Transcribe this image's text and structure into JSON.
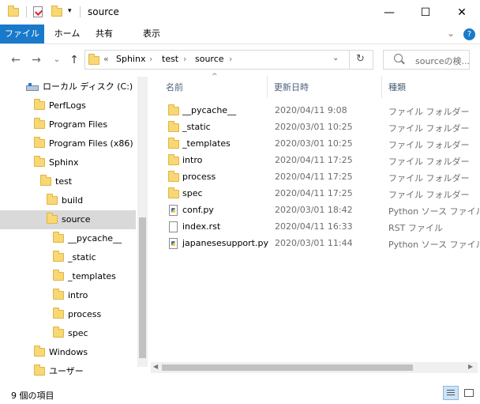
{
  "window": {
    "title": "source",
    "minimize_glyph": "—",
    "maximize_glyph": "☐",
    "close_glyph": "✕"
  },
  "ribbon": {
    "tabs": [
      "ファイル",
      "ホーム",
      "共有",
      "表示"
    ],
    "collapse_glyph": "⌄",
    "help_glyph": "?"
  },
  "nav": {
    "back_glyph": "←",
    "forward_glyph": "→",
    "recent_glyph": "⌄",
    "up_glyph": "↑",
    "overflow": "«",
    "breadcrumbs": [
      "Sphinx",
      "test",
      "source"
    ],
    "refresh_glyph": "↻",
    "search_placeholder": "sourceの検..."
  },
  "tree": [
    {
      "label": "ローカル ディスク (C:)",
      "icon": "drive-icon"
    },
    {
      "label": "PerfLogs",
      "icon": "folder-icon"
    },
    {
      "label": "Program Files",
      "icon": "folder-icon"
    },
    {
      "label": "Program Files (x86)",
      "icon": "folder-icon"
    },
    {
      "label": "Sphinx",
      "icon": "folder-icon"
    },
    {
      "label": "test",
      "icon": "folder-icon"
    },
    {
      "label": "build",
      "icon": "folder-icon"
    },
    {
      "label": "source",
      "icon": "folder-icon",
      "selected": true
    },
    {
      "label": "__pycache__",
      "icon": "folder-icon"
    },
    {
      "label": "_static",
      "icon": "folder-icon"
    },
    {
      "label": "_templates",
      "icon": "folder-icon"
    },
    {
      "label": "intro",
      "icon": "folder-icon"
    },
    {
      "label": "process",
      "icon": "folder-icon"
    },
    {
      "label": "spec",
      "icon": "folder-icon"
    },
    {
      "label": "Windows",
      "icon": "folder-icon"
    },
    {
      "label": "ユーザー",
      "icon": "folder-icon"
    }
  ],
  "columns": {
    "name": "名前",
    "date": "更新日時",
    "type": "種類",
    "sort_glyph": "^"
  },
  "files": [
    {
      "name": "__pycache__",
      "date": "2020/04/11 9:08",
      "type": "ファイル フォルダー",
      "icon": "folder-icon"
    },
    {
      "name": "_static",
      "date": "2020/03/01 10:25",
      "type": "ファイル フォルダー",
      "icon": "folder-icon"
    },
    {
      "name": "_templates",
      "date": "2020/03/01 10:25",
      "type": "ファイル フォルダー",
      "icon": "folder-icon"
    },
    {
      "name": "intro",
      "date": "2020/04/11 17:25",
      "type": "ファイル フォルダー",
      "icon": "folder-icon"
    },
    {
      "name": "process",
      "date": "2020/04/11 17:25",
      "type": "ファイル フォルダー",
      "icon": "folder-icon"
    },
    {
      "name": "spec",
      "date": "2020/04/11 17:25",
      "type": "ファイル フォルダー",
      "icon": "folder-icon"
    },
    {
      "name": "conf.py",
      "date": "2020/03/01 18:42",
      "type": "Python ソース ファイル",
      "icon": "python-file-icon"
    },
    {
      "name": "index.rst",
      "date": "2020/04/11 16:33",
      "type": "RST ファイル",
      "icon": "document-icon"
    },
    {
      "name": "japanesesupport.py",
      "date": "2020/03/01 11:44",
      "type": "Python ソース ファイル",
      "icon": "python-file-icon"
    }
  ],
  "status": {
    "item_count": "9 個の項目"
  },
  "colors": {
    "file_tab": "#1979ca",
    "selection": "#d9d9d9",
    "folder": "#f8d775"
  }
}
